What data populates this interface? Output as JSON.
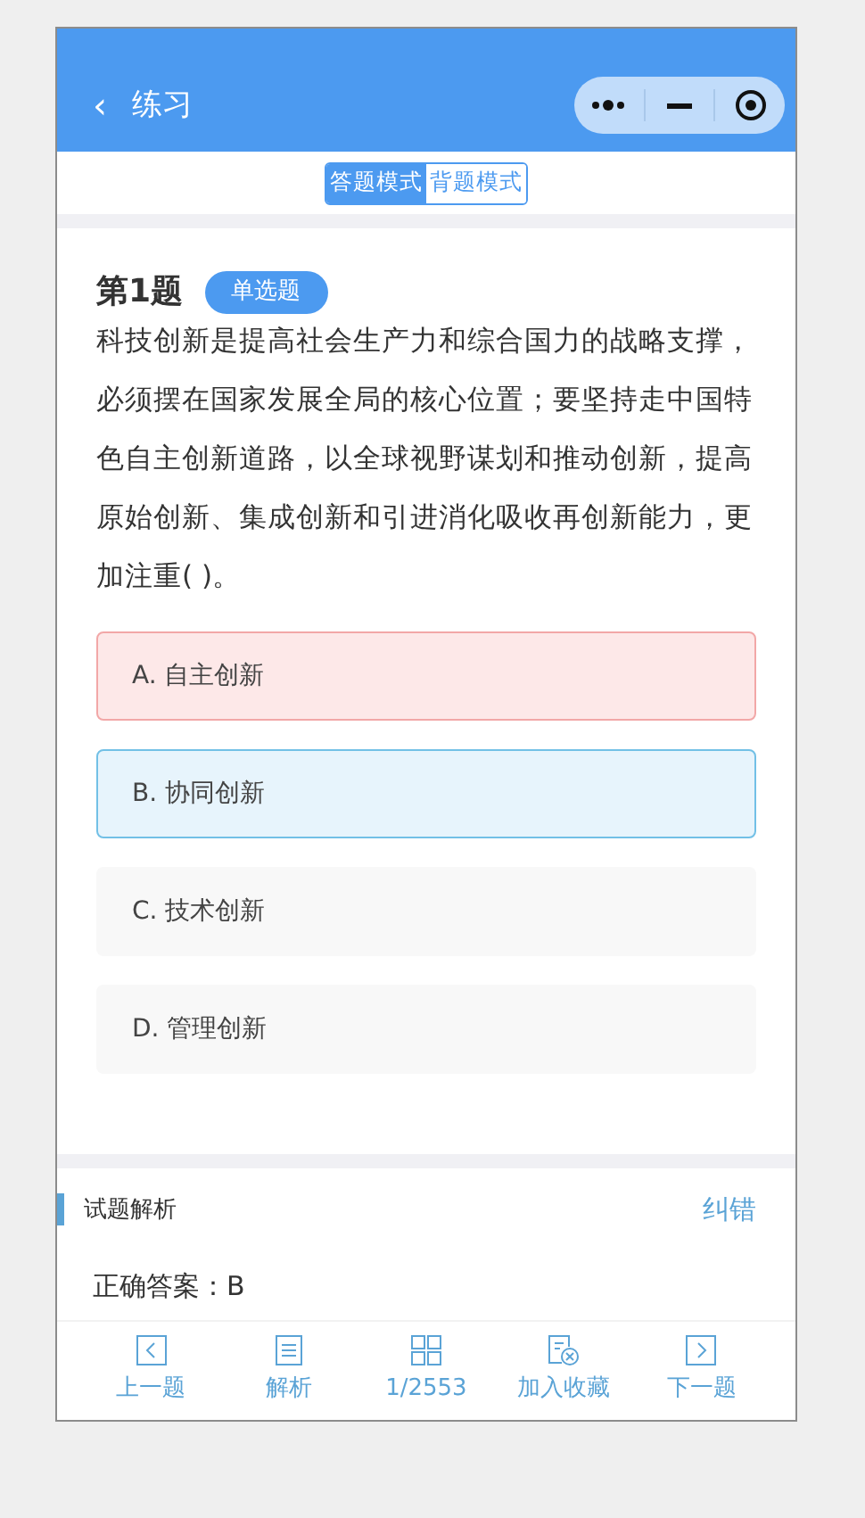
{
  "header": {
    "back": "‹",
    "title": "练习"
  },
  "mode_tabs": [
    {
      "label": "答题模式",
      "selected": true
    },
    {
      "label": "背题模式",
      "selected": false
    }
  ],
  "question": {
    "number": "第1题",
    "type": "单选题",
    "text": "科技创新是提高社会生产力和综合国力的战略支撑，必须摆在国家发展全局的核心位置；要坚持走中国特色自主创新道路，以全球视野谋划和推动创新，提高原始创新、集成创新和引进消化吸收再创新能力，更加注重( )。",
    "options": [
      {
        "label": "A. 自主创新",
        "wrong": true,
        "correct": false
      },
      {
        "label": "B. 协同创新",
        "wrong": false,
        "correct": true
      },
      {
        "label": "C. 技术创新",
        "wrong": false,
        "correct": false
      },
      {
        "label": "D. 管理创新",
        "wrong": false,
        "correct": false
      }
    ]
  },
  "analysis": {
    "title": "试题解析",
    "report": "纠错",
    "answer": "正确答案：B"
  },
  "toolbar": [
    {
      "kind": "prev",
      "label": "上一题"
    },
    {
      "kind": "analysis",
      "label": "解析"
    },
    {
      "kind": "grid",
      "label": "1/2553"
    },
    {
      "kind": "favorite",
      "label": "加入收藏"
    },
    {
      "kind": "next",
      "label": "下一题"
    }
  ]
}
